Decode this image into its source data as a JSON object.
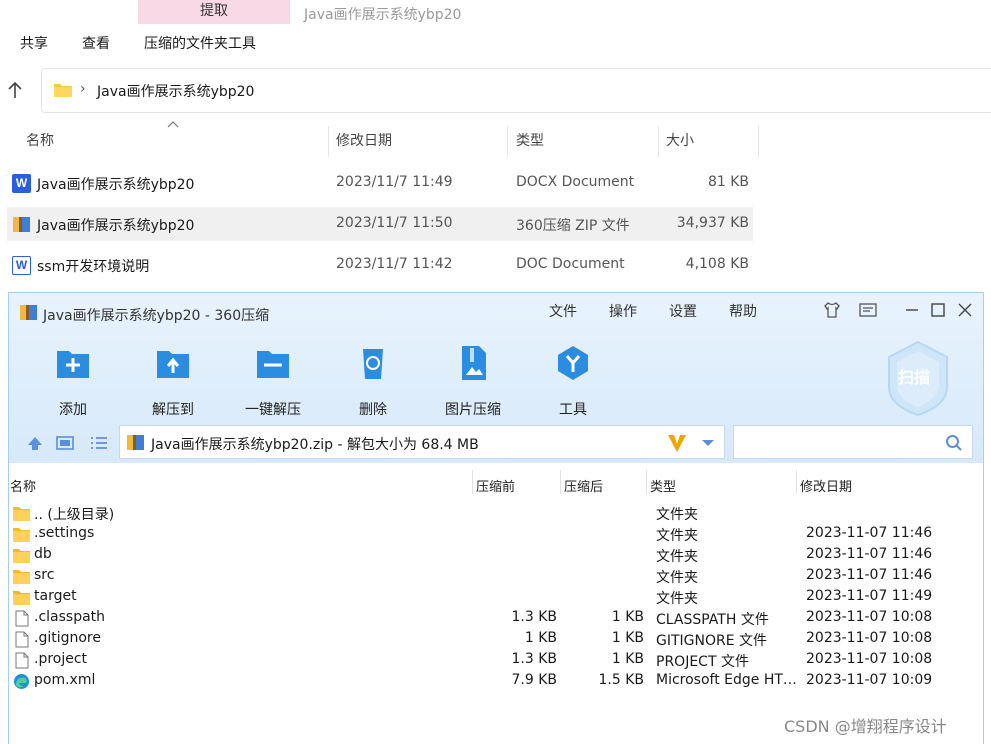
{
  "explorer": {
    "extract_tab": "提取",
    "window_title": "Java画作展示系统ybp20",
    "ribbon_tabs": [
      "共享",
      "查看",
      "压缩的文件夹工具"
    ],
    "address": {
      "separator": "›",
      "path": "Java画作展示系统ybp20"
    },
    "columns": {
      "name": "名称",
      "date": "修改日期",
      "type": "类型",
      "size": "大小"
    },
    "files": [
      {
        "name": "Java画作展示系统ybp20",
        "date": "2023/11/7 11:49",
        "type": "DOCX Document",
        "size": "81 KB",
        "icon": "word-icon"
      },
      {
        "name": "Java画作展示系统ybp20",
        "date": "2023/11/7 11:50",
        "type": "360压缩 ZIP 文件",
        "size": "34,937 KB",
        "icon": "zip-icon"
      },
      {
        "name": "ssm开发环境说明",
        "date": "2023/11/7 11:42",
        "type": "DOC Document",
        "size": "4,108 KB",
        "icon": "word-doc-icon"
      }
    ]
  },
  "zip": {
    "title": "Java画作展示系统ybp20 - 360压缩",
    "menu": [
      "文件",
      "操作",
      "设置",
      "帮助"
    ],
    "tools": [
      "添加",
      "解压到",
      "一键解压",
      "删除",
      "图片压缩",
      "工具"
    ],
    "scan_label": "扫描",
    "path": "Java画作展示系统ybp20.zip - 解包大小为 68.4 MB",
    "search_placeholder": "",
    "columns": {
      "name": "名称",
      "before": "压缩前",
      "after": "压缩后",
      "type": "类型",
      "date": "修改日期"
    },
    "rows": [
      {
        "name": ".. (上级目录)",
        "before": "",
        "after": "",
        "type": "文件夹",
        "date": "",
        "icon": "folder-icon"
      },
      {
        "name": ".settings",
        "before": "",
        "after": "",
        "type": "文件夹",
        "date": "2023-11-07 11:46",
        "icon": "folder-icon"
      },
      {
        "name": "db",
        "before": "",
        "after": "",
        "type": "文件夹",
        "date": "2023-11-07 11:46",
        "icon": "folder-icon"
      },
      {
        "name": "src",
        "before": "",
        "after": "",
        "type": "文件夹",
        "date": "2023-11-07 11:46",
        "icon": "folder-icon"
      },
      {
        "name": "target",
        "before": "",
        "after": "",
        "type": "文件夹",
        "date": "2023-11-07 11:49",
        "icon": "folder-icon"
      },
      {
        "name": ".classpath",
        "before": "1.3 KB",
        "after": "1 KB",
        "type": "CLASSPATH 文件",
        "date": "2023-11-07 10:08",
        "icon": "file-icon"
      },
      {
        "name": ".gitignore",
        "before": "1 KB",
        "after": "1 KB",
        "type": "GITIGNORE 文件",
        "date": "2023-11-07 10:08",
        "icon": "file-icon"
      },
      {
        "name": ".project",
        "before": "1.3 KB",
        "after": "1 KB",
        "type": "PROJECT 文件",
        "date": "2023-11-07 10:08",
        "icon": "file-icon"
      },
      {
        "name": "pom.xml",
        "before": "7.9 KB",
        "after": "1.5 KB",
        "type": "Microsoft Edge HT…",
        "date": "2023-11-07 10:09",
        "icon": "edge-icon"
      }
    ]
  },
  "watermark": "CSDN @增翔程序设计"
}
